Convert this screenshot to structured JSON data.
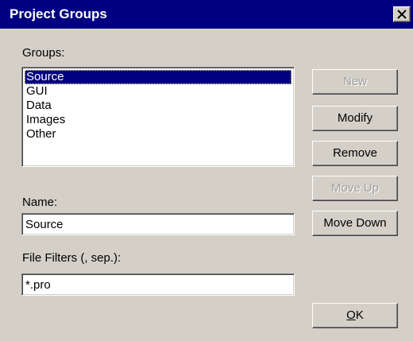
{
  "window": {
    "title": "Project Groups",
    "close_icon": "close-icon"
  },
  "groups": {
    "label": "Groups:",
    "items": [
      "Source",
      "GUI",
      "Data",
      "Images",
      "Other"
    ],
    "selected_index": 0
  },
  "name": {
    "label": "Name:",
    "value": "Source"
  },
  "file_filters": {
    "label": "File Filters (, sep.):",
    "value": "*.pro"
  },
  "buttons": {
    "new": {
      "label": "New",
      "enabled": false
    },
    "modify": {
      "label": "Modify",
      "enabled": true
    },
    "remove": {
      "label": "Remove",
      "enabled": true
    },
    "move_up": {
      "label": "Move Up",
      "enabled": false
    },
    "move_down": {
      "label": "Move Down",
      "enabled": true
    },
    "ok": {
      "label_mnemonic": "O",
      "label_rest": "K",
      "enabled": true
    }
  },
  "colors": {
    "titlebar": "#000080",
    "dialog_face": "#d4d0c8",
    "selection": "#000080",
    "disabled_text": "#a0a0a0"
  }
}
